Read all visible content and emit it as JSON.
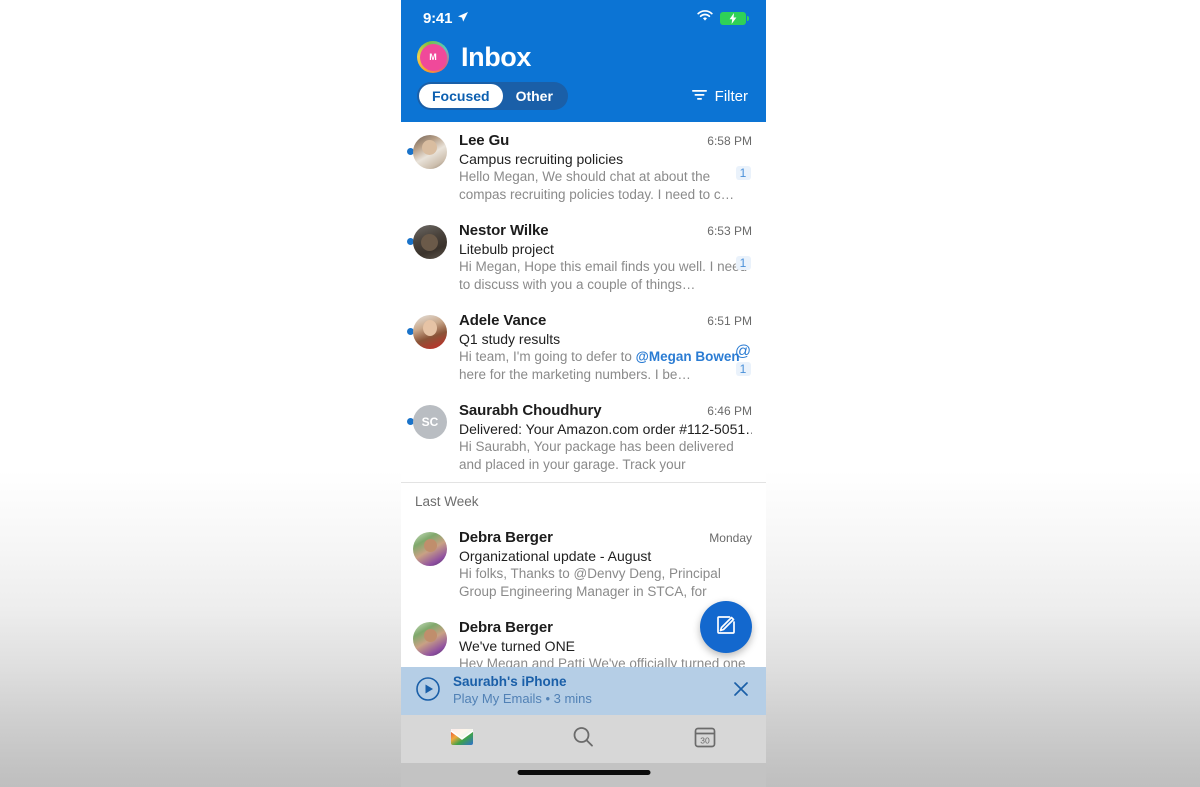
{
  "status_bar": {
    "time": "9:41",
    "location_icon": "location-arrow-icon",
    "wifi_icon": "wifi-icon",
    "battery_icon": "battery-charging-icon"
  },
  "header": {
    "avatar_initial": "M",
    "title": "Inbox",
    "pivot": [
      {
        "label": "Focused",
        "active": true
      },
      {
        "label": "Other",
        "active": false
      }
    ],
    "filter_label": "Filter",
    "filter_icon": "filter-icon",
    "background_color": "#0c74d4"
  },
  "list": {
    "messages": [
      {
        "sender": "Lee Gu",
        "time": "6:58 PM",
        "subject": "Campus recruiting policies",
        "preview_line1": "Hello Megan, We should chat at about the",
        "preview_line2": "compas recruiting policies today. I need to c…",
        "unread": true,
        "count": "1",
        "mention": false,
        "avatar_type": "photo"
      },
      {
        "sender": "Nestor Wilke",
        "time": "6:53 PM",
        "subject": "Litebulb project",
        "preview_line1": "Hi Megan, Hope this email finds you well. I",
        "preview_line2": "need to discuss with you a couple of things…",
        "unread": true,
        "count": "1",
        "mention": false,
        "avatar_type": "photo"
      },
      {
        "sender": "Adele Vance",
        "time": "6:51 PM",
        "subject": "Q1 study results",
        "preview_pre": "Hi team, I'm going to defer to ",
        "preview_mention1": "@Megan",
        "preview_mention2": "Bowen",
        "preview_post": " here for the marketing numbers. I be…",
        "unread": true,
        "count": "1",
        "mention": true,
        "mention_icon": "at-mention-icon",
        "avatar_type": "photo"
      },
      {
        "sender": "Saurabh Choudhury",
        "time": "6:46 PM",
        "subject": "Delivered: Your Amazon.com order #112-5051…",
        "preview_line1": "Hi Saurabh, Your package has been delivered",
        "preview_line2": "and placed in your garage. Track your package…",
        "unread": true,
        "count": "",
        "mention": false,
        "avatar_type": "initials",
        "avatar_initials": "SC"
      }
    ],
    "section_header": "Last Week",
    "last_week_messages": [
      {
        "sender": "Debra Berger",
        "time": "Monday",
        "subject": "Organizational update - August",
        "preview_line1": "Hi folks, Thanks to @Denvy Deng, Principal",
        "preview_line2": "Group Engineering Manager in STCA, for shari…",
        "unread": false,
        "count": "",
        "avatar_type": "photo"
      },
      {
        "sender": "Debra Berger",
        "time": "",
        "subject": "We've turned ONE",
        "preview_line1": "Hey Megan and Patti We've officially turned one",
        "preview_line2": "",
        "unread": false,
        "count": "",
        "avatar_type": "photo"
      }
    ]
  },
  "compose_fab": {
    "icon": "compose-pencil-icon",
    "color": "#1368ce"
  },
  "player": {
    "play_icon": "play-circle-icon",
    "title": "Saurabh's iPhone",
    "subtitle": "Play My Emails • 3 mins",
    "close_icon": "close-icon",
    "background_color": "#b5cee6"
  },
  "tab_bar": {
    "tabs": [
      {
        "name": "mail-tab",
        "icon": "outlook-mail-icon",
        "active": true
      },
      {
        "name": "search-tab",
        "icon": "search-icon",
        "active": false
      },
      {
        "name": "calendar-tab",
        "icon": "calendar-30-icon",
        "active": false
      }
    ],
    "calendar_day": "30"
  }
}
